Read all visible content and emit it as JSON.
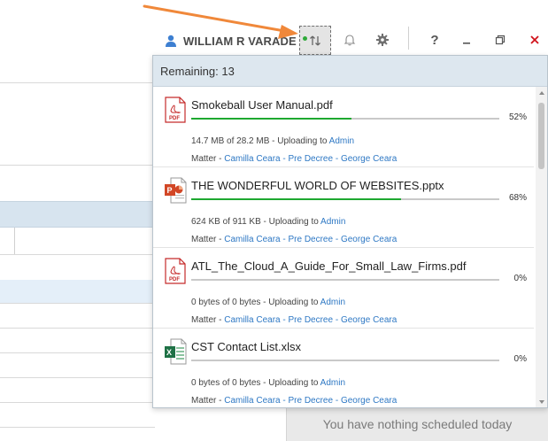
{
  "header": {
    "user_name": "WILLIAM R VARADE",
    "sync_icon": "sync-arrows-icon",
    "notification_icon": "bell-icon",
    "settings_icon": "gear-icon",
    "help_label": "?",
    "minimize_icon": "minimize-icon",
    "restore_icon": "restore-icon",
    "close_icon": "close-icon",
    "close_color": "#d0121b",
    "sync_status_color": "#2faa3a"
  },
  "uploads": {
    "remaining_label": "Remaining: 13",
    "matter_prefix": "Matter -",
    "items": [
      {
        "file_name": "Smokeball User Manual.pdf",
        "file_type": "pdf",
        "progress": 52,
        "progress_label": "52%",
        "status_text": "14.7 MB of 28.2 MB - Uploading to",
        "uploader": "Admin",
        "matter": "Camilla Ceara - Pre Decree - George Ceara"
      },
      {
        "file_name": "THE WONDERFUL WORLD OF WEBSITES.pptx",
        "file_type": "pptx",
        "progress": 68,
        "progress_label": "68%",
        "status_text": "624 KB of 911 KB - Uploading to",
        "uploader": "Admin",
        "matter": "Camilla Ceara - Pre Decree - George Ceara"
      },
      {
        "file_name": "ATL_The_Cloud_A_Guide_For_Small_Law_Firms.pdf",
        "file_type": "pdf",
        "progress": 0,
        "progress_label": "0%",
        "status_text": "0 bytes of 0 bytes - Uploading to",
        "uploader": "Admin",
        "matter": "Camilla Ceara - Pre Decree - George Ceara"
      },
      {
        "file_name": "CST Contact List.xlsx",
        "file_type": "xlsx",
        "progress": 0,
        "progress_label": "0%",
        "status_text": "0 bytes of 0 bytes - Uploading to",
        "uploader": "Admin",
        "matter": "Camilla Ceara - Pre Decree - George Ceara"
      }
    ]
  },
  "schedule": {
    "empty_text": "You have nothing scheduled today"
  },
  "annotation": {
    "arrow_color": "#f0883a"
  }
}
